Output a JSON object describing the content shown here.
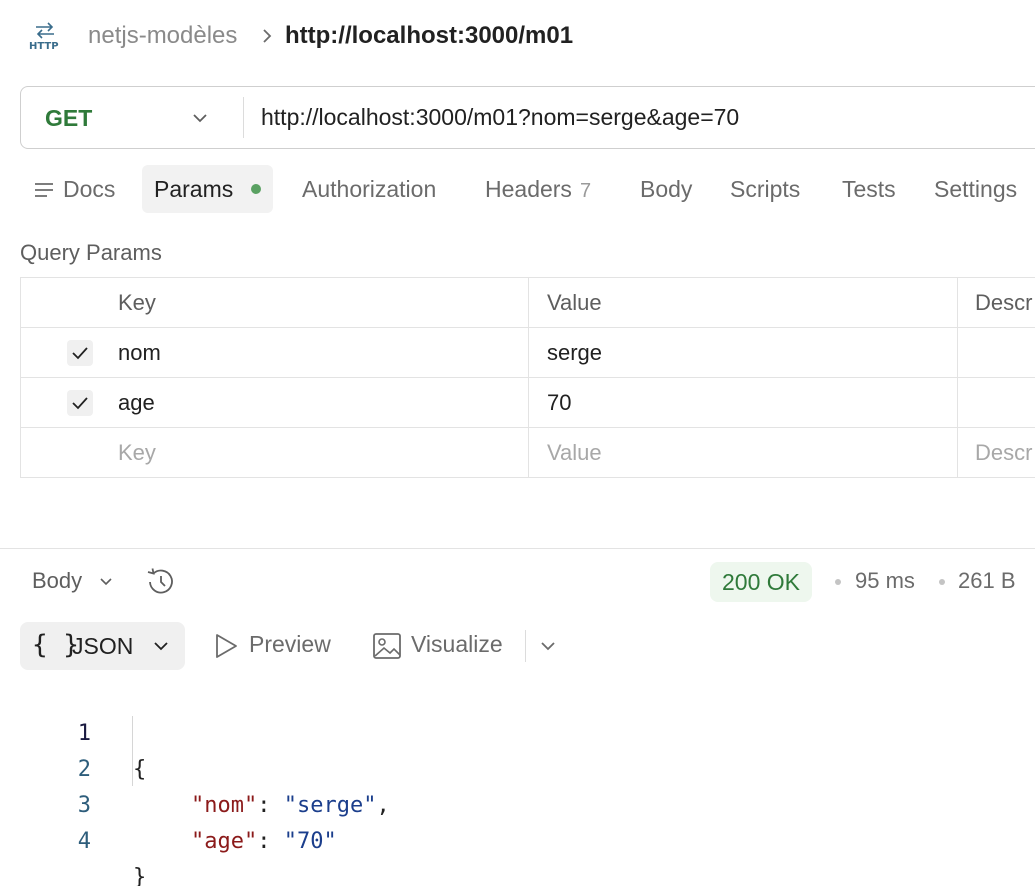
{
  "header": {
    "collection": "netjs-modèles",
    "request_name": "http://localhost:3000/m01"
  },
  "request": {
    "method": "GET",
    "url": "http://localhost:3000/m01?nom=serge&age=70"
  },
  "tabs": [
    {
      "label": "Docs"
    },
    {
      "label": "Params",
      "active": true,
      "indicator": "green-dot"
    },
    {
      "label": "Authorization"
    },
    {
      "label": "Headers",
      "count": "7"
    },
    {
      "label": "Body"
    },
    {
      "label": "Scripts"
    },
    {
      "label": "Tests"
    },
    {
      "label": "Settings"
    }
  ],
  "query_params": {
    "title": "Query Params",
    "columns": {
      "key": "Key",
      "value": "Value",
      "description": "Descr"
    },
    "rows": [
      {
        "checked": true,
        "key": "nom",
        "value": "serge",
        "description": ""
      },
      {
        "checked": true,
        "key": "age",
        "value": "70",
        "description": ""
      }
    ],
    "placeholders": {
      "key": "Key",
      "value": "Value",
      "description": "Descr"
    }
  },
  "response": {
    "view_label": "Body",
    "status": "200 OK",
    "status_color": "#2f7a3a",
    "time": "95 ms",
    "size": "261 B",
    "format": {
      "braces": "{ }",
      "label": "JSON"
    },
    "preview_label": "Preview",
    "visualize_label": "Visualize",
    "lines": [
      {
        "n": "1",
        "text": "{"
      },
      {
        "n": "2",
        "key": "\"nom\"",
        "sep": ": ",
        "val": "\"serge\"",
        "end": ","
      },
      {
        "n": "3",
        "key": "\"age\"",
        "sep": ": ",
        "val": "\"70\"",
        "end": ""
      },
      {
        "n": "4",
        "text": "}"
      }
    ]
  }
}
